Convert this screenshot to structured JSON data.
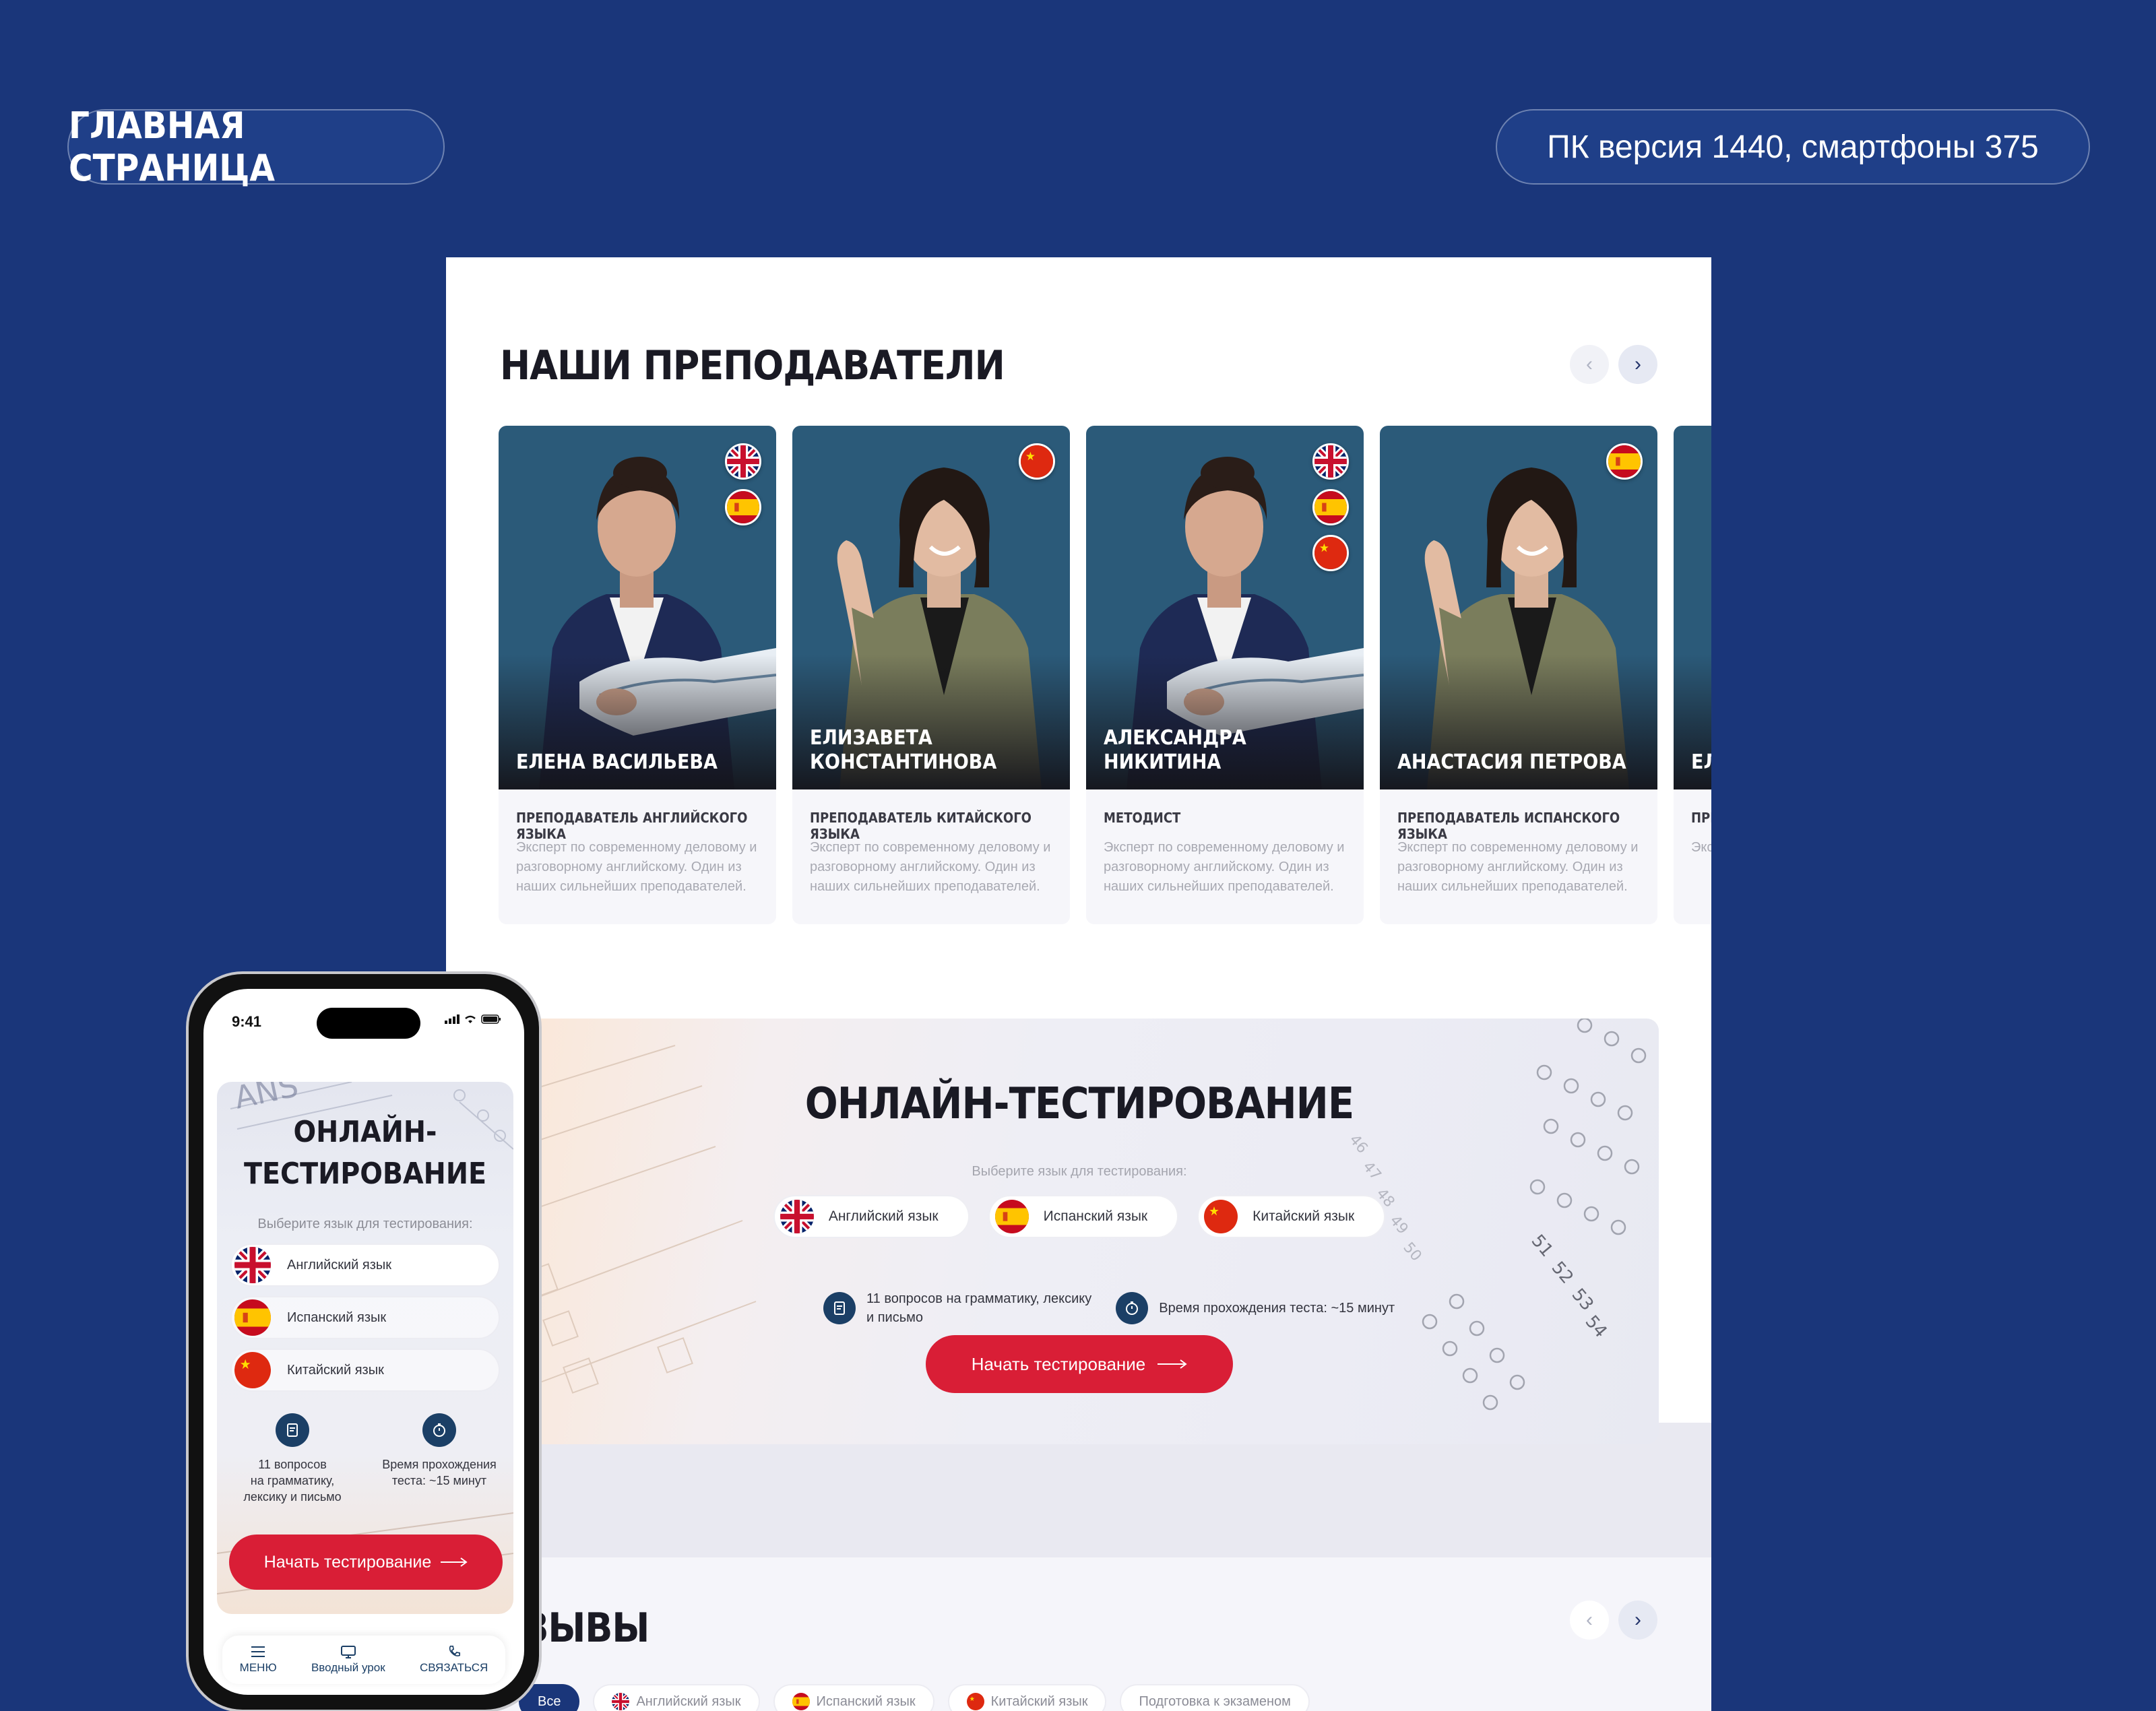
{
  "header": {
    "page_label": "ГЛАВНАЯ СТРАНИЦА",
    "versions_label": "ПК версия 1440, смартфоны 375"
  },
  "teachers": {
    "title": "НАШИ ПРЕПОДАВАТЕЛИ",
    "prev_label": "‹",
    "next_label": "›",
    "items": [
      {
        "name": "ЕЛЕНА ВАСИЛЬЕВА",
        "role": "ПРЕПОДАВАТЕЛЬ АНГЛИЙСКОГО ЯЗЫКА",
        "desc": "Эксперт по современному деловому и разговорному английскому. Один из наших сильнейших преподавателей.",
        "flags": [
          "uk",
          "es"
        ]
      },
      {
        "name": "ЕЛИЗАВЕТА КОНСТАНТИНОВА",
        "role": "ПРЕПОДАВАТЕЛЬ КИТАЙСКОГО ЯЗЫКА",
        "desc": "Эксперт по современному деловому и разговорному английскому. Один из наших сильнейших преподавателей.",
        "flags": [
          "cn"
        ]
      },
      {
        "name": "АЛЕКСАНДРА НИКИТИНА",
        "role": "МЕТОДИСТ",
        "desc": "Эксперт по современному деловому и разговорному английскому. Один из наших сильнейших преподавателей.",
        "flags": [
          "uk",
          "es",
          "cn"
        ]
      },
      {
        "name": "АНАСТАСИЯ ПЕТРОВА",
        "role": "ПРЕПОДАВАТЕЛЬ ИСПАНСКОГО ЯЗЫКА",
        "desc": "Эксперт по современному деловому и разговорному английскому. Один из наших сильнейших преподавателей.",
        "flags": [
          "es"
        ]
      },
      {
        "name": "ЕЛ",
        "role": "ПРЕ",
        "desc": "Экс деп анг сил",
        "flags": []
      }
    ]
  },
  "testing": {
    "title": "ОНЛАЙН-ТЕСТИРОВАНИЕ",
    "mobile_title_line1": "ОНЛАЙН-",
    "mobile_title_line2": "ТЕСТИРОВАНИЕ",
    "subtitle": "Выберите язык для тестирования:",
    "languages": [
      {
        "label": "Английский язык",
        "flag": "uk"
      },
      {
        "label": "Испанский язык",
        "flag": "es"
      },
      {
        "label": "Китайский язык",
        "flag": "cn"
      }
    ],
    "info_questions": "11 вопросов на грамматику, лексику и письмо",
    "info_questions_line1": "11 вопросов на грамматику, лексику",
    "info_questions_line2": "и письмо",
    "info_time": "Время прохождения теста: ~15 минут",
    "mobile_info_questions_l1": "11 вопросов",
    "mobile_info_questions_l2": "на грамматику,",
    "mobile_info_questions_l3": "лексику и письмо",
    "mobile_info_time_l1": "Время прохождения",
    "mobile_info_time_l2": "теста: ~15 минут",
    "cta": "Начать тестирование"
  },
  "reviews": {
    "title": "ЗЫВЫ",
    "filters": [
      "Все",
      "Английский язык",
      "Испанский язык",
      "Китайский язык",
      "Подготовка к экзаменом"
    ]
  },
  "phone": {
    "time": "9:41",
    "tabbar": [
      {
        "label": "МЕНЮ",
        "icon": "menu-icon"
      },
      {
        "label": "Вводный урок",
        "icon": "monitor-icon"
      },
      {
        "label": "СВЯЗАТЬСЯ",
        "icon": "phone-icon"
      }
    ]
  },
  "colors": {
    "background": "#1a367a",
    "accent_red": "#d91e36",
    "icon_navy": "#1b3f66",
    "photo_bg": "#2b5a79"
  }
}
